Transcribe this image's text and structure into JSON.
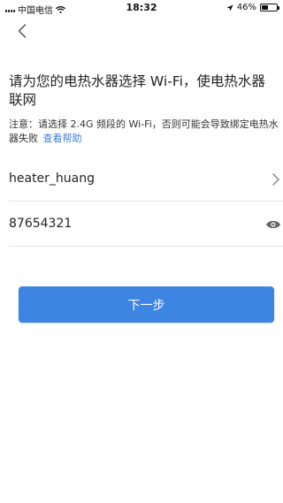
{
  "status_bar": {
    "carrier": "中国电信",
    "time": "18:32",
    "battery": "46%",
    "battery_level": 0.46,
    "icons": [
      "signal-icon",
      "wifi-icon",
      "location-arrow-icon",
      "battery-icon"
    ]
  },
  "header": {
    "back_icon": "chevron-left-icon"
  },
  "page": {
    "title": "请为您的电热水器选择 Wi-Fi，使电热水器联网",
    "notice": "注意：请选择 2.4G 频段的 Wi-Fi，否则可能会导致绑定电热水器失败",
    "help_link": "查看帮助"
  },
  "form": {
    "ssid": "heater_huang",
    "password": "87654321",
    "ssid_icon": "chevron-right-icon",
    "password_icon": "eye-icon"
  },
  "actions": {
    "next_label": "下一步"
  },
  "colors": {
    "accent": "#3d85e0",
    "link": "#3c7fd8",
    "divider": "#e6e6e6"
  }
}
